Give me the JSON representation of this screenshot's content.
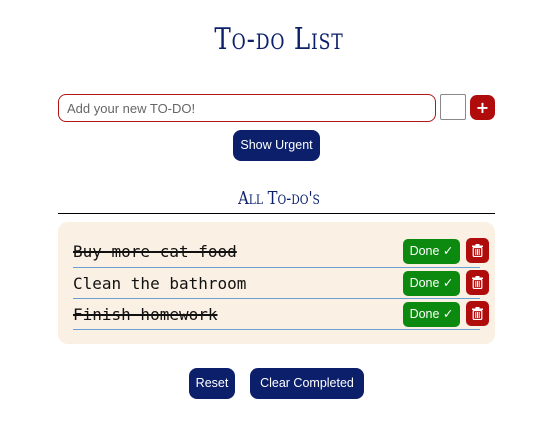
{
  "header": {
    "title": "To-do List"
  },
  "add_form": {
    "placeholder": "Add your new TO-DO!",
    "value": "",
    "add_label": "+"
  },
  "controls": {
    "show_urgent_label": "Show Urgent",
    "reset_label": "Reset",
    "clear_completed_label": "Clear Completed"
  },
  "list": {
    "title": "All To-do's",
    "done_label": "Done ✓",
    "items": [
      {
        "text": "Buy more cat food",
        "completed": true
      },
      {
        "text": "Clean the bathroom",
        "completed": false
      },
      {
        "text": "Finish homework",
        "completed": true
      }
    ]
  },
  "colors": {
    "navy": "#0b1f6b",
    "red": "#b00c0c",
    "green": "#0c8a10",
    "panel": "#faf0e3"
  },
  "icons": {
    "add": "plus-icon",
    "delete": "trash-icon",
    "done": "checkmark-icon"
  }
}
